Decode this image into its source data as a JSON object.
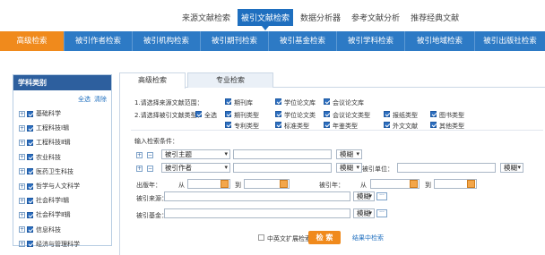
{
  "top_tabs": [
    "来源文献检索",
    "被引文献检索",
    "数据分析器",
    "参考文献分析",
    "推荐经典文献"
  ],
  "nav": [
    "高级检索",
    "被引作者检索",
    "被引机构检索",
    "被引期刊检索",
    "被引基金检索",
    "被引学科检索",
    "被引地域检索",
    "被引出版社检索"
  ],
  "sidebar": {
    "title": "学科类别",
    "select_all": "全选",
    "clear": "清除",
    "items": [
      "基础科学",
      "工程科技Ⅰ辑",
      "工程科技Ⅱ辑",
      "农业科技",
      "医药卫生科技",
      "哲学与人文科学",
      "社会科学Ⅰ辑",
      "社会科学Ⅱ辑",
      "信息科技",
      "经济与管理科学"
    ]
  },
  "main_tabs": [
    "高级检索",
    "专业检索"
  ],
  "form": {
    "range_label": "1.请选择来源文献范围：",
    "range_options": [
      "期刊库",
      "学位论文库",
      "会议论文库"
    ],
    "type_label": "2.请选择被引文献类型：",
    "select_all": "全选",
    "types_row1": [
      "期刊类型",
      "学位论文类",
      "会议论文类型",
      "报纸类型",
      "图书类型"
    ],
    "types_row2": [
      "专利类型",
      "标准类型",
      "年鉴类型",
      "外文文献",
      "其他类型"
    ],
    "cond_label": "输入检索条件：",
    "field1": "被引主题",
    "field2": "被引作者",
    "match": "模糊",
    "unit_label": "被引单位：",
    "pub_year_label": "出版年：",
    "from": "从",
    "to": "到",
    "cited_year_label": "被引年：",
    "source_label": "被引来源：",
    "fund_label": "被引基金：",
    "ext_label": "中英文扩展检索",
    "search_btn": "检 索",
    "result_search": "结果中检索"
  }
}
